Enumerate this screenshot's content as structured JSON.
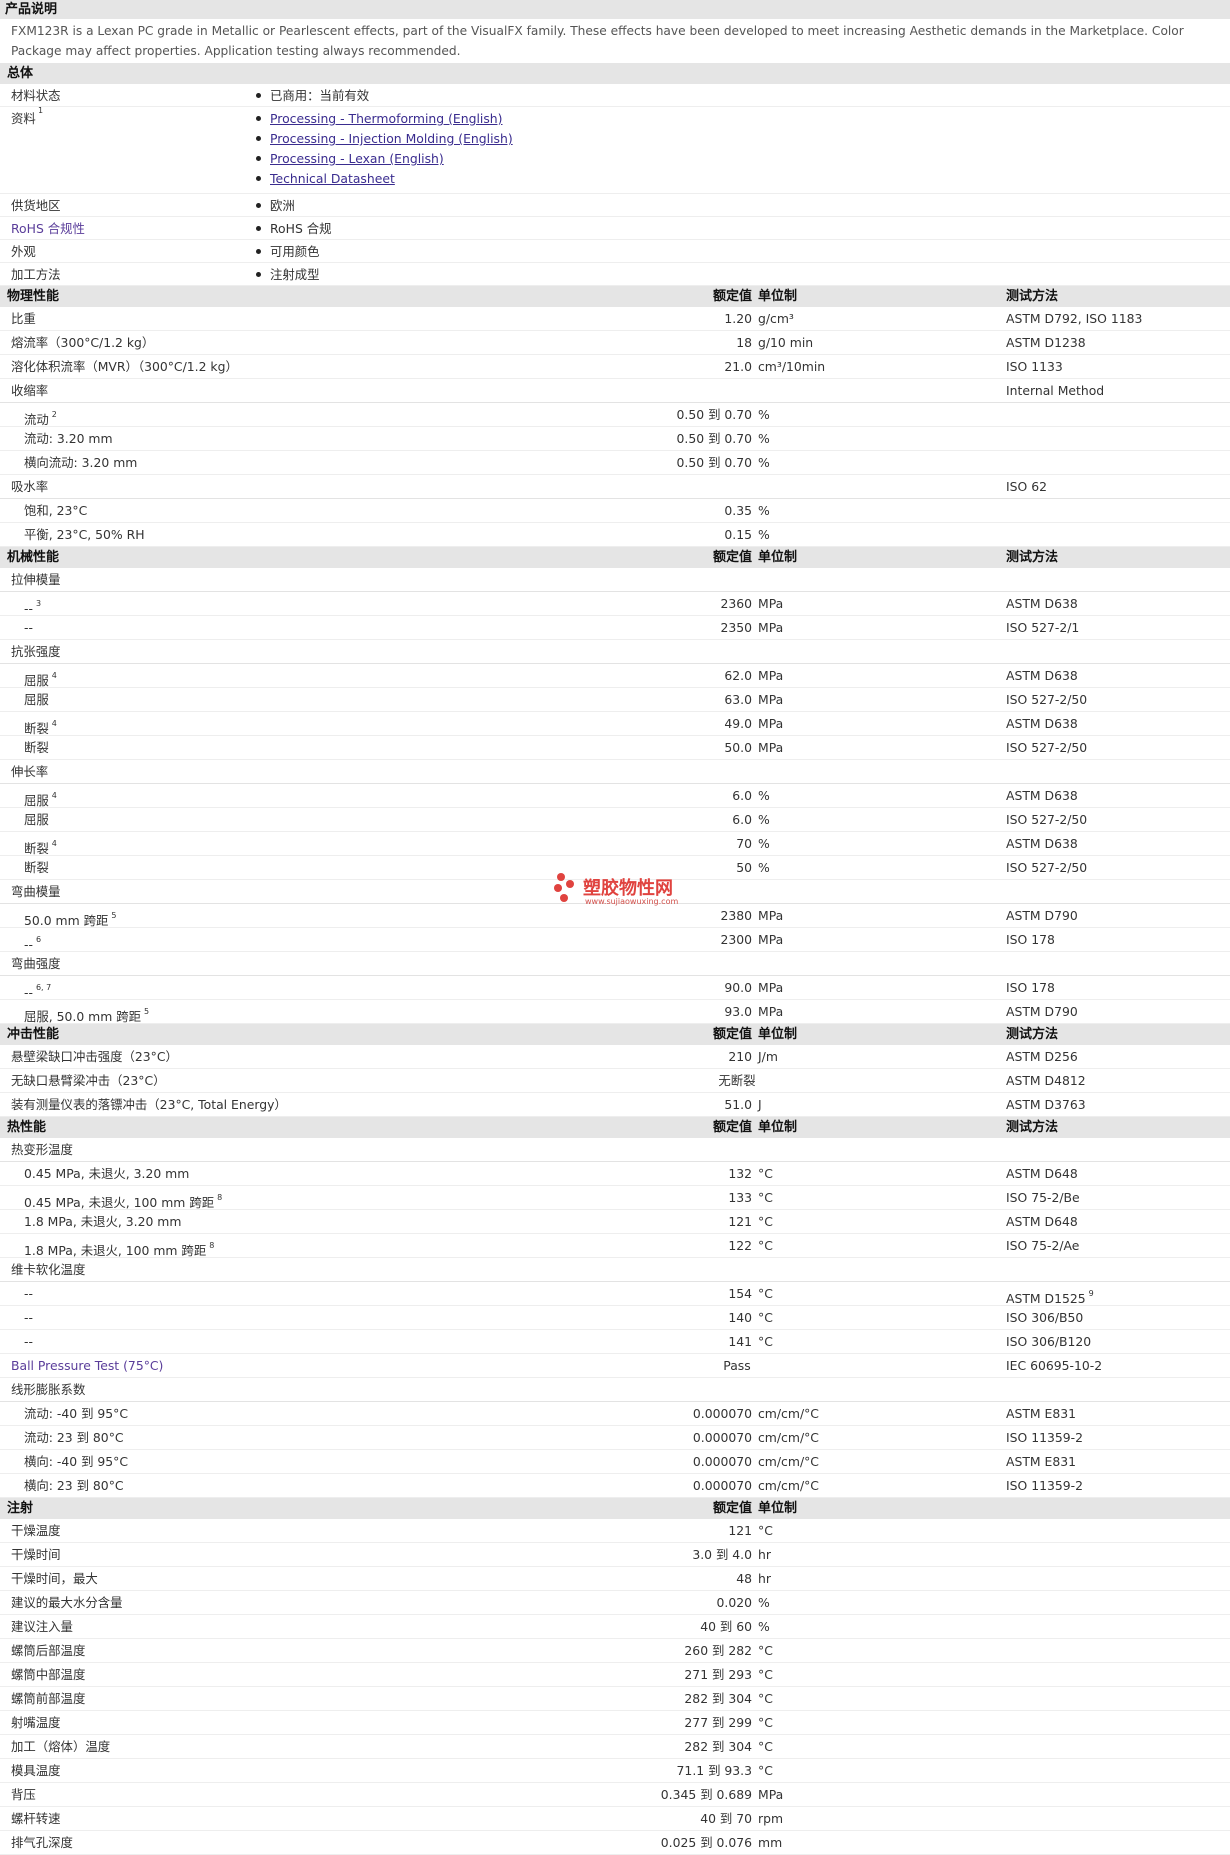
{
  "description": {
    "title": "产品说明",
    "text": "FXM123R is a Lexan PC grade in Metallic or Pearlescent effects, part of the VisualFX family. These effects have been developed to meet increasing Aesthetic demands in the Marketplace. Color Package may affect properties. Application testing always recommended."
  },
  "general": {
    "title": "总体",
    "rows": [
      {
        "label": "材料状态",
        "values": [
          "已商用：当前有效"
        ]
      },
      {
        "label": "资料",
        "sup": "1",
        "links": [
          "Processing - Thermoforming (English)",
          "Processing - Injection Molding (English)",
          "Processing - Lexan (English)",
          "Technical Datasheet"
        ]
      },
      {
        "label": "供货地区",
        "values": [
          "欧洲"
        ]
      },
      {
        "label": "RoHS 合规性",
        "values": [
          "RoHS 合规"
        ]
      },
      {
        "label": "外观",
        "values": [
          "可用颜色"
        ]
      },
      {
        "label": "加工方法",
        "values": [
          "注射成型"
        ]
      }
    ]
  },
  "headers": {
    "value": "额定值",
    "unit": "单位制",
    "method": "测试方法"
  },
  "watermark": {
    "text": "塑胶物性网",
    "url": "www.sujiaowuxing.com"
  },
  "sections": [
    {
      "title": "物理性能",
      "show_method": true,
      "rows": [
        {
          "label": "比重",
          "value": "1.20",
          "unit": "g/cm³",
          "method": "ASTM D792, ISO 1183"
        },
        {
          "label": "熔流率（300°C/1.2 kg）",
          "value": "18",
          "unit": "g/10 min",
          "method": "ASTM D1238"
        },
        {
          "label": "溶化体积流率（MVR）（300°C/1.2 kg）",
          "value": "21.0",
          "unit": "cm³/10min",
          "method": "ISO 1133"
        },
        {
          "label": "收缩率",
          "group": true,
          "method": "Internal Method"
        },
        {
          "label": "流动",
          "sup": "2",
          "sub": true,
          "value": "0.50 到 0.70",
          "unit": "%"
        },
        {
          "label": "流动: 3.20 mm",
          "sub": true,
          "value": "0.50 到 0.70",
          "unit": "%"
        },
        {
          "label": "横向流动: 3.20 mm",
          "sub": true,
          "value": "0.50 到 0.70",
          "unit": "%"
        },
        {
          "label": "吸水率",
          "group": true,
          "method": "ISO 62"
        },
        {
          "label": "饱和, 23°C",
          "sub": true,
          "value": "0.35",
          "unit": "%"
        },
        {
          "label": "平衡, 23°C, 50% RH",
          "sub": true,
          "value": "0.15",
          "unit": "%"
        }
      ]
    },
    {
      "title": "机械性能",
      "show_method": true,
      "rows": [
        {
          "label": "拉伸模量",
          "group": true
        },
        {
          "label": "--",
          "sup": "3",
          "sub": true,
          "value": "2360",
          "unit": "MPa",
          "method": "ASTM D638"
        },
        {
          "label": "--",
          "sub": true,
          "value": "2350",
          "unit": "MPa",
          "method": "ISO 527-2/1"
        },
        {
          "label": "抗张强度",
          "group": true
        },
        {
          "label": "屈服",
          "sup": "4",
          "sub": true,
          "value": "62.0",
          "unit": "MPa",
          "method": "ASTM D638"
        },
        {
          "label": "屈服",
          "sub": true,
          "value": "63.0",
          "unit": "MPa",
          "method": "ISO 527-2/50"
        },
        {
          "label": "断裂",
          "sup": "4",
          "sub": true,
          "value": "49.0",
          "unit": "MPa",
          "method": "ASTM D638"
        },
        {
          "label": "断裂",
          "sub": true,
          "value": "50.0",
          "unit": "MPa",
          "method": "ISO 527-2/50"
        },
        {
          "label": "伸长率",
          "group": true
        },
        {
          "label": "屈服",
          "sup": "4",
          "sub": true,
          "value": "6.0",
          "unit": "%",
          "method": "ASTM D638"
        },
        {
          "label": "屈服",
          "sub": true,
          "value": "6.0",
          "unit": "%",
          "method": "ISO 527-2/50"
        },
        {
          "label": "断裂",
          "sup": "4",
          "sub": true,
          "value": "70",
          "unit": "%",
          "method": "ASTM D638"
        },
        {
          "label": "断裂",
          "sub": true,
          "value": "50",
          "unit": "%",
          "method": "ISO 527-2/50"
        },
        {
          "label": "弯曲模量",
          "group": true
        },
        {
          "label": "50.0 mm 跨距",
          "sup": "5",
          "sub": true,
          "value": "2380",
          "unit": "MPa",
          "method": "ASTM D790"
        },
        {
          "label": "--",
          "sup": "6",
          "sub": true,
          "value": "2300",
          "unit": "MPa",
          "method": "ISO 178"
        },
        {
          "label": "弯曲强度",
          "group": true
        },
        {
          "label": "--",
          "sup": "6, 7",
          "sub": true,
          "value": "90.0",
          "unit": "MPa",
          "method": "ISO 178"
        },
        {
          "label": "屈服, 50.0 mm 跨距",
          "sup": "5",
          "sub": true,
          "value": "93.0",
          "unit": "MPa",
          "method": "ASTM D790"
        }
      ]
    },
    {
      "title": "冲击性能",
      "show_method": true,
      "rows": [
        {
          "label": "悬壁梁缺口冲击强度（23°C）",
          "value": "210",
          "unit": "J/m",
          "method": "ASTM D256"
        },
        {
          "label": "无缺口悬臂梁冲击（23°C）",
          "value": "无断裂",
          "center": true,
          "method": "ASTM D4812"
        },
        {
          "label": "装有测量仪表的落镖冲击（23°C, Total Energy）",
          "value": "51.0",
          "unit": "J",
          "method": "ASTM D3763"
        }
      ]
    },
    {
      "title": "热性能",
      "show_method": true,
      "rows": [
        {
          "label": "热变形温度",
          "group": true
        },
        {
          "label": "0.45 MPa, 未退火, 3.20 mm",
          "sub": true,
          "value": "132",
          "unit": "°C",
          "method": "ASTM D648"
        },
        {
          "label": "0.45 MPa, 未退火, 100 mm 跨距",
          "sup": "8",
          "sub": true,
          "value": "133",
          "unit": "°C",
          "method": "ISO 75-2/Be"
        },
        {
          "label": "1.8 MPa, 未退火, 3.20 mm",
          "sub": true,
          "value": "121",
          "unit": "°C",
          "method": "ASTM D648"
        },
        {
          "label": "1.8 MPa, 未退火, 100 mm 跨距",
          "sup": "8",
          "sub": true,
          "value": "122",
          "unit": "°C",
          "method": "ISO 75-2/Ae"
        },
        {
          "label": "维卡软化温度",
          "group": true
        },
        {
          "label": "--",
          "sub": true,
          "value": "154",
          "unit": "°C",
          "method": "ASTM D1525",
          "method_sup": "9"
        },
        {
          "label": "--",
          "sub": true,
          "value": "140",
          "unit": "°C",
          "method": "ISO 306/B50"
        },
        {
          "label": "--",
          "sub": true,
          "value": "141",
          "unit": "°C",
          "method": "ISO 306/B120"
        },
        {
          "label": "Ball Pressure Test (75°C)",
          "purple": true,
          "value": "Pass",
          "center": true,
          "method": "IEC 60695-10-2"
        },
        {
          "label": "线形膨胀系数",
          "group": true
        },
        {
          "label": "流动: -40 到 95°C",
          "sub": true,
          "value": "0.000070",
          "unit": "cm/cm/°C",
          "method": "ASTM E831"
        },
        {
          "label": "流动: 23 到 80°C",
          "sub": true,
          "value": "0.000070",
          "unit": "cm/cm/°C",
          "method": "ISO 11359-2"
        },
        {
          "label": "横向: -40 到 95°C",
          "sub": true,
          "value": "0.000070",
          "unit": "cm/cm/°C",
          "method": "ASTM E831"
        },
        {
          "label": "横向: 23 到 80°C",
          "sub": true,
          "value": "0.000070",
          "unit": "cm/cm/°C",
          "method": "ISO 11359-2"
        }
      ]
    },
    {
      "title": "注射",
      "show_method": false,
      "rows": [
        {
          "label": "干燥温度",
          "value": "121",
          "unit": "°C"
        },
        {
          "label": "干燥时间",
          "value": "3.0 到 4.0",
          "unit": "hr"
        },
        {
          "label": "干燥时间，最大",
          "value": "48",
          "unit": "hr"
        },
        {
          "label": "建议的最大水分含量",
          "value": "0.020",
          "unit": "%"
        },
        {
          "label": "建议注入量",
          "value": "40 到 60",
          "unit": "%"
        },
        {
          "label": "螺筒后部温度",
          "value": "260 到 282",
          "unit": "°C"
        },
        {
          "label": "螺筒中部温度",
          "value": "271 到 293",
          "unit": "°C"
        },
        {
          "label": "螺筒前部温度",
          "value": "282 到 304",
          "unit": "°C"
        },
        {
          "label": "射嘴温度",
          "value": "277 到 299",
          "unit": "°C"
        },
        {
          "label": "加工（熔体）温度",
          "value": "282 到 304",
          "unit": "°C"
        },
        {
          "label": "模具温度",
          "value": "71.1 到 93.3",
          "unit": "°C"
        },
        {
          "label": "背压",
          "value": "0.345 到 0.689",
          "unit": "MPa"
        },
        {
          "label": "螺杆转速",
          "value": "40 到 70",
          "unit": "rpm"
        },
        {
          "label": "排气孔深度",
          "value": "0.025 到 0.076",
          "unit": "mm"
        }
      ]
    }
  ]
}
